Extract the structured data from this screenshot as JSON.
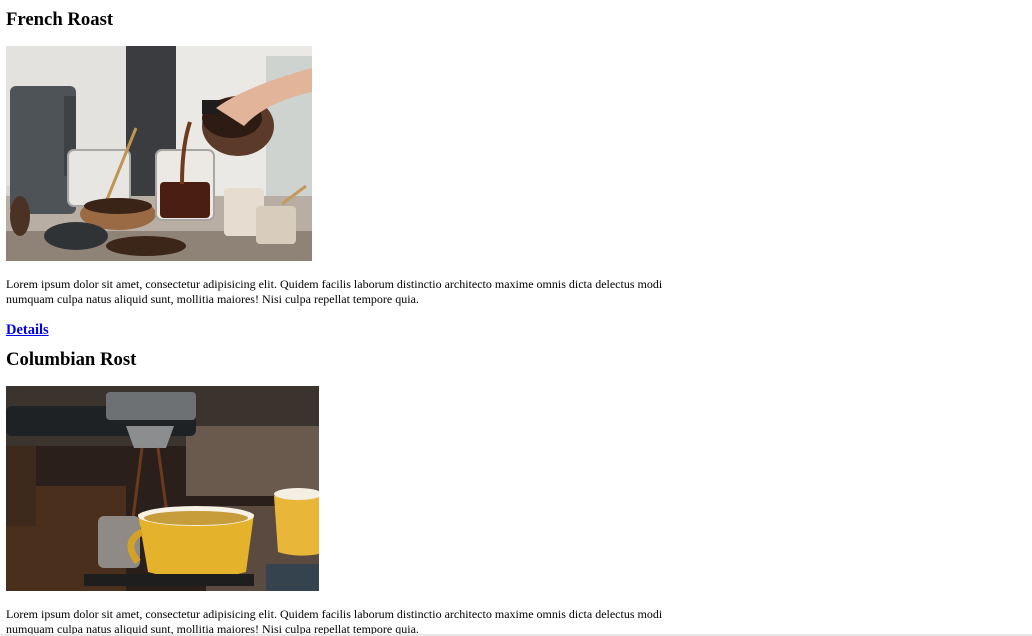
{
  "products": [
    {
      "title": "French Roast",
      "image_description": "coffee-pour-over",
      "description": "Lorem ipsum dolor sit amet, consectetur adipisicing elit. Quidem facilis laborum distinctio architecto maxime omnis dicta delectus modi numquam culpa natus aliquid sunt, mollitia maiores! Nisi culpa repellat tempore quia.",
      "link_label": "Details"
    },
    {
      "title": "Columbian Rost",
      "image_description": "espresso-machine-yellow-cup",
      "description": "Lorem ipsum dolor sit amet, consectetur adipisicing elit. Quidem facilis laborum distinctio architecto maxime omnis dicta delectus modi numquam culpa natus aliquid sunt, mollitia maiores! Nisi culpa repellat tempore quia."
    }
  ],
  "colors": {
    "link": "#0000ee",
    "text": "#000000",
    "background": "#ffffff"
  }
}
